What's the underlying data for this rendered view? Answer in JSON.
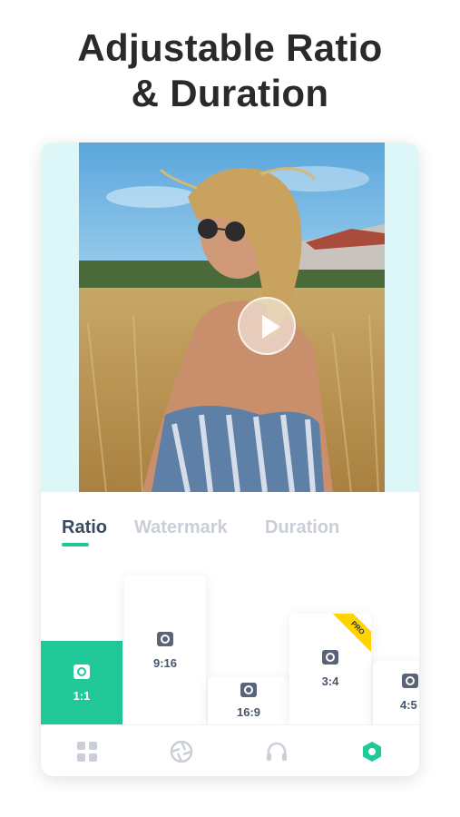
{
  "headline": {
    "line1": "Adjustable Ratio",
    "line2": "& Duration"
  },
  "preview": {
    "play_icon": "play-icon"
  },
  "tabs": [
    {
      "label": "Ratio",
      "active": true
    },
    {
      "label": "Watermark",
      "active": false
    },
    {
      "label": "Duration",
      "active": false
    }
  ],
  "ratios": [
    {
      "label": "1:1",
      "icon": "instagram-icon",
      "selected": true
    },
    {
      "label": "9:16",
      "icon": "instagram-icon",
      "selected": false
    },
    {
      "label": "16:9",
      "icon": "instagram-icon",
      "selected": false
    },
    {
      "label": "3:4",
      "icon": "camera-icon",
      "selected": false,
      "badge": "PRO"
    },
    {
      "label": "4:5",
      "icon": "camera-icon",
      "selected": false
    }
  ],
  "bottom_nav": [
    {
      "icon": "grid-icon",
      "active": false
    },
    {
      "icon": "aperture-icon",
      "active": false
    },
    {
      "icon": "headphones-icon",
      "active": false
    },
    {
      "icon": "hexagon-icon",
      "active": true
    }
  ],
  "colors": {
    "accent": "#20c997",
    "tab_active": "#3b4a63",
    "tab_inactive": "#c9ced8",
    "preview_bg": "#ddf6f8",
    "pro_badge": "#ffd400"
  }
}
